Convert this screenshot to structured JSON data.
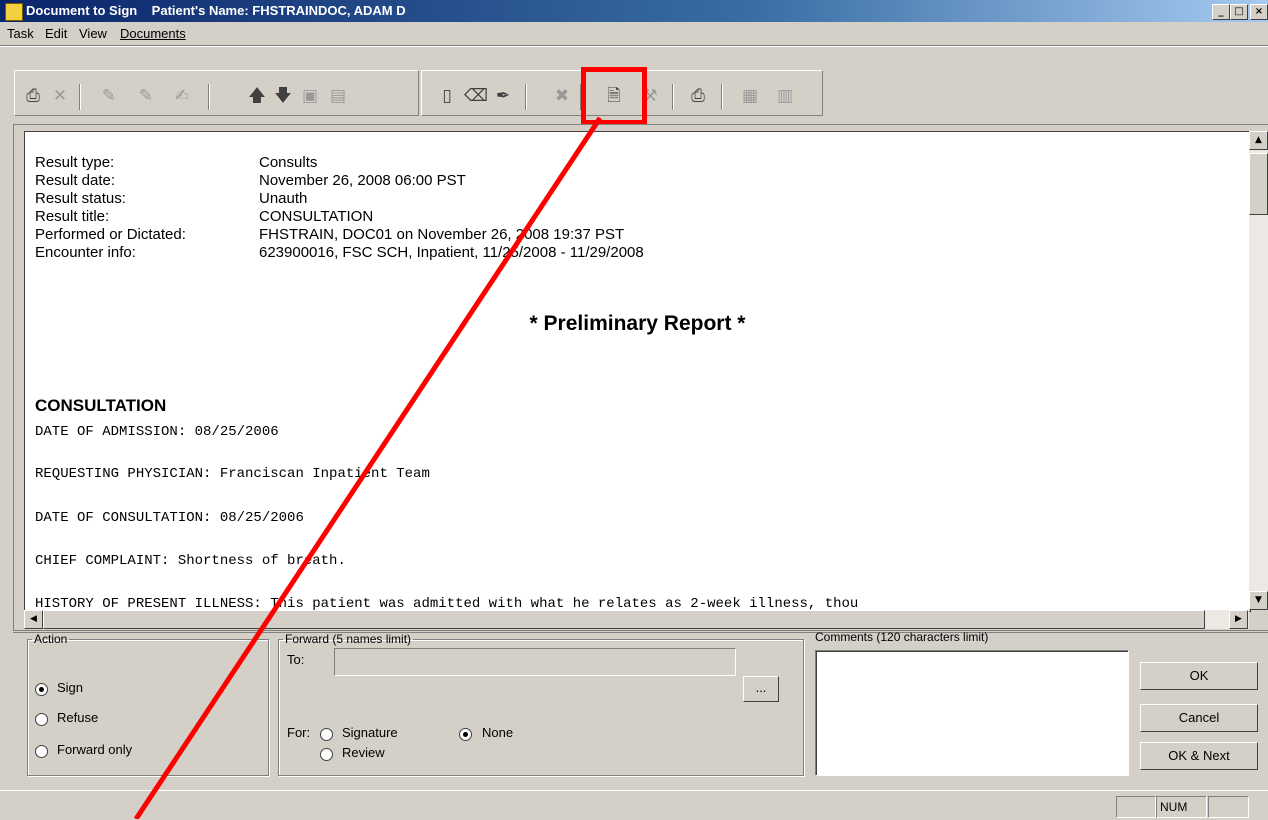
{
  "window": {
    "title": "Document to Sign    Patient's Name: FHSTRAINDOC, ADAM D",
    "minimize": "_",
    "maximize": "□",
    "close": "×"
  },
  "menu": [
    "Task",
    "Edit",
    "View",
    "Documents"
  ],
  "document": {
    "fields": [
      {
        "label": "Result type:",
        "value": "Consults"
      },
      {
        "label": "Result date:",
        "value": "November 26, 2008 06:00 PST"
      },
      {
        "label": "Result status:",
        "value": "Unauth"
      },
      {
        "label": "Result title:",
        "value": "CONSULTATION"
      },
      {
        "label": "Performed or Dictated:",
        "value": "FHSTRAIN, DOC01 on November 26, 2008 19:37 PST"
      },
      {
        "label": "Encounter info:",
        "value": "623900016, FSC SCH, Inpatient, 11/25/2008 - 11/29/2008"
      }
    ],
    "banner": "* Preliminary Report *",
    "section_title": "CONSULTATION",
    "lines": [
      "DATE OF ADMISSION:  08/25/2006",
      "REQUESTING PHYSICIAN:  Franciscan Inpatient Team",
      "DATE OF CONSULTATION:  08/25/2006",
      "CHIEF COMPLAINT:  Shortness of breath.",
      "HISTORY OF PRESENT ILLNESS:  This patient was admitted with what he relates as 2-week illness, thou"
    ]
  },
  "action": {
    "legend": "Action",
    "options": [
      "Sign",
      "Refuse",
      "Forward only"
    ],
    "selected": "Sign"
  },
  "forward": {
    "legend": "Forward (5 names limit)",
    "to_label": "To:",
    "to_value": "",
    "browse_label": "...",
    "for_label": "For:",
    "for_options": [
      "Signature",
      "None",
      "Review"
    ],
    "selected": "None"
  },
  "comments": {
    "legend": "Comments (120 characters limit)",
    "value": ""
  },
  "buttons": {
    "ok": "OK",
    "cancel": "Cancel",
    "ok_next": "OK & Next"
  },
  "status": {
    "num": "NUM"
  },
  "annotation_color": "#ff0000"
}
